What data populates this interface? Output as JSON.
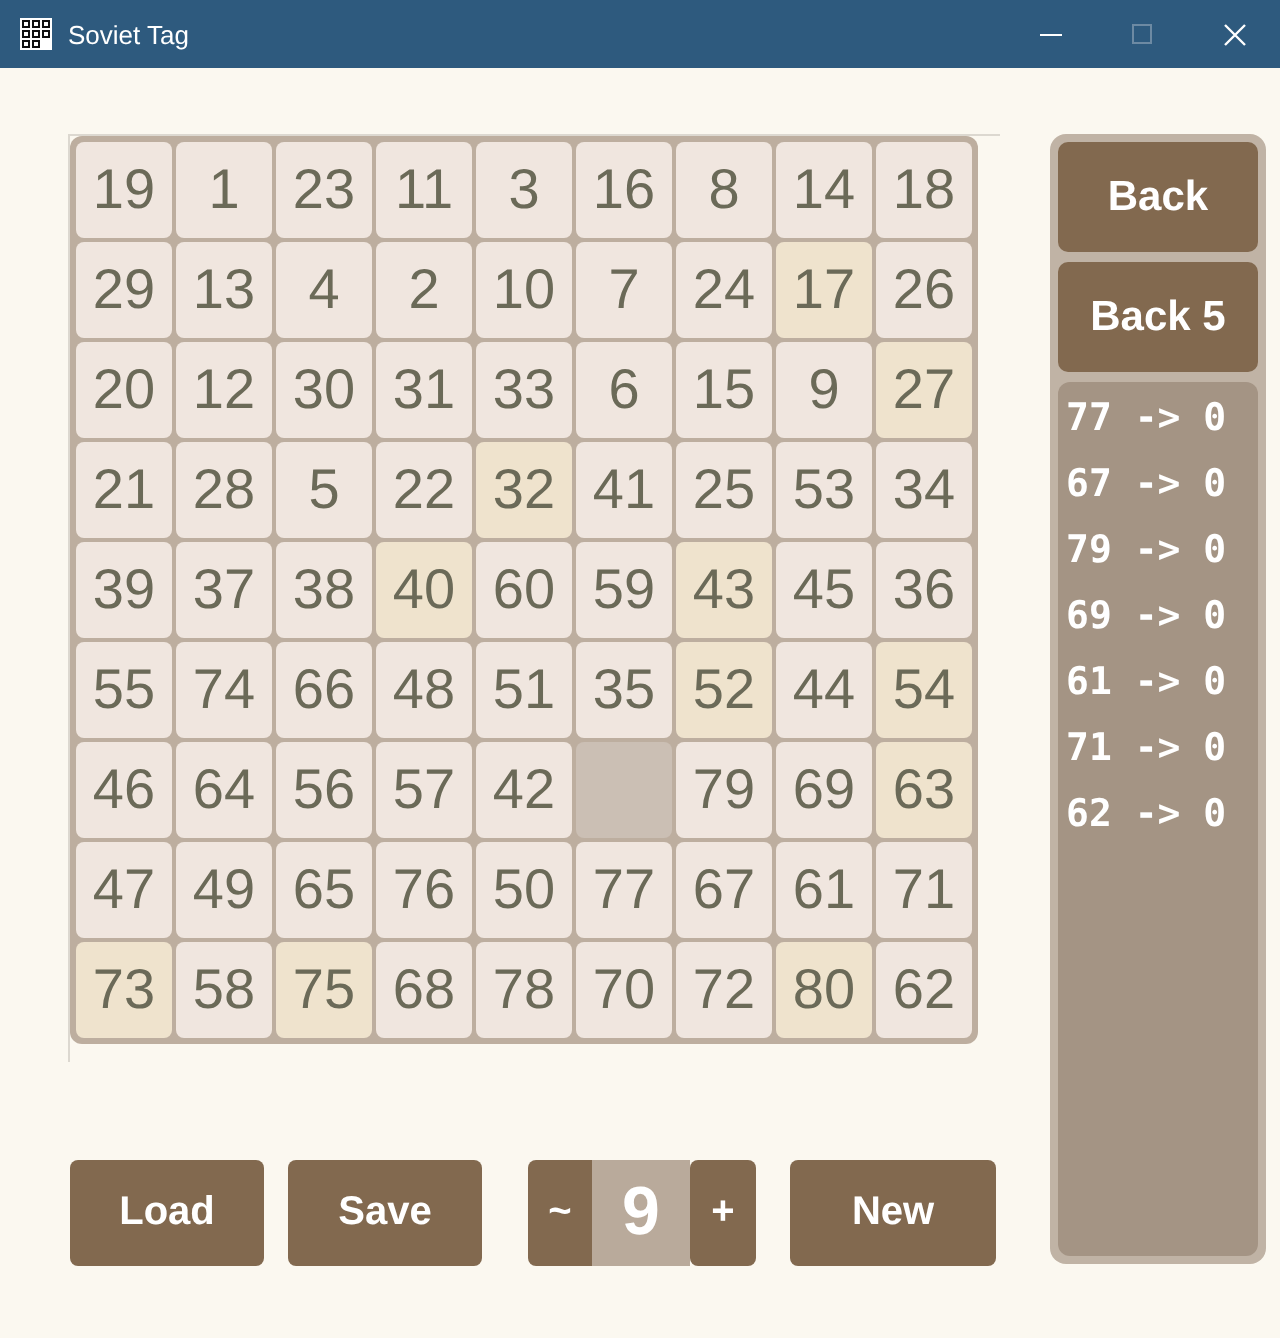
{
  "window": {
    "title": "Soviet Tag",
    "controls": [
      {
        "kind": "minimize",
        "disabled": false
      },
      {
        "kind": "maximize",
        "disabled": true
      },
      {
        "kind": "close",
        "disabled": false
      }
    ]
  },
  "board": {
    "rows": [
      [
        {
          "kind": "tile",
          "value": "19",
          "highlighted": false
        },
        {
          "kind": "tile",
          "value": "1",
          "highlighted": false
        },
        {
          "kind": "tile",
          "value": "23",
          "highlighted": false
        },
        {
          "kind": "tile",
          "value": "11",
          "highlighted": false
        },
        {
          "kind": "tile",
          "value": "3",
          "highlighted": false
        },
        {
          "kind": "tile",
          "value": "16",
          "highlighted": false
        },
        {
          "kind": "tile",
          "value": "8",
          "highlighted": false
        },
        {
          "kind": "tile",
          "value": "14",
          "highlighted": false
        },
        {
          "kind": "tile",
          "value": "18",
          "highlighted": false
        }
      ],
      [
        {
          "kind": "tile",
          "value": "29",
          "highlighted": false
        },
        {
          "kind": "tile",
          "value": "13",
          "highlighted": false
        },
        {
          "kind": "tile",
          "value": "4",
          "highlighted": false
        },
        {
          "kind": "tile",
          "value": "2",
          "highlighted": false
        },
        {
          "kind": "tile",
          "value": "10",
          "highlighted": false
        },
        {
          "kind": "tile",
          "value": "7",
          "highlighted": false
        },
        {
          "kind": "tile",
          "value": "24",
          "highlighted": false
        },
        {
          "kind": "tile",
          "value": "17",
          "highlighted": true
        },
        {
          "kind": "tile",
          "value": "26",
          "highlighted": false
        }
      ],
      [
        {
          "kind": "tile",
          "value": "20",
          "highlighted": false
        },
        {
          "kind": "tile",
          "value": "12",
          "highlighted": false
        },
        {
          "kind": "tile",
          "value": "30",
          "highlighted": false
        },
        {
          "kind": "tile",
          "value": "31",
          "highlighted": false
        },
        {
          "kind": "tile",
          "value": "33",
          "highlighted": false
        },
        {
          "kind": "tile",
          "value": "6",
          "highlighted": false
        },
        {
          "kind": "tile",
          "value": "15",
          "highlighted": false
        },
        {
          "kind": "tile",
          "value": "9",
          "highlighted": false
        },
        {
          "kind": "tile",
          "value": "27",
          "highlighted": true
        }
      ],
      [
        {
          "kind": "tile",
          "value": "21",
          "highlighted": false
        },
        {
          "kind": "tile",
          "value": "28",
          "highlighted": false
        },
        {
          "kind": "tile",
          "value": "5",
          "highlighted": false
        },
        {
          "kind": "tile",
          "value": "22",
          "highlighted": false
        },
        {
          "kind": "tile",
          "value": "32",
          "highlighted": true
        },
        {
          "kind": "tile",
          "value": "41",
          "highlighted": false
        },
        {
          "kind": "tile",
          "value": "25",
          "highlighted": false
        },
        {
          "kind": "tile",
          "value": "53",
          "highlighted": false
        },
        {
          "kind": "tile",
          "value": "34",
          "highlighted": false
        }
      ],
      [
        {
          "kind": "tile",
          "value": "39",
          "highlighted": false
        },
        {
          "kind": "tile",
          "value": "37",
          "highlighted": false
        },
        {
          "kind": "tile",
          "value": "38",
          "highlighted": false
        },
        {
          "kind": "tile",
          "value": "40",
          "highlighted": true
        },
        {
          "kind": "tile",
          "value": "60",
          "highlighted": false
        },
        {
          "kind": "tile",
          "value": "59",
          "highlighted": false
        },
        {
          "kind": "tile",
          "value": "43",
          "highlighted": true
        },
        {
          "kind": "tile",
          "value": "45",
          "highlighted": false
        },
        {
          "kind": "tile",
          "value": "36",
          "highlighted": false
        }
      ],
      [
        {
          "kind": "tile",
          "value": "55",
          "highlighted": false
        },
        {
          "kind": "tile",
          "value": "74",
          "highlighted": false
        },
        {
          "kind": "tile",
          "value": "66",
          "highlighted": false
        },
        {
          "kind": "tile",
          "value": "48",
          "highlighted": false
        },
        {
          "kind": "tile",
          "value": "51",
          "highlighted": false
        },
        {
          "kind": "tile",
          "value": "35",
          "highlighted": false
        },
        {
          "kind": "tile",
          "value": "52",
          "highlighted": true
        },
        {
          "kind": "tile",
          "value": "44",
          "highlighted": false
        },
        {
          "kind": "tile",
          "value": "54",
          "highlighted": true
        }
      ],
      [
        {
          "kind": "tile",
          "value": "46",
          "highlighted": false
        },
        {
          "kind": "tile",
          "value": "64",
          "highlighted": false
        },
        {
          "kind": "tile",
          "value": "56",
          "highlighted": false
        },
        {
          "kind": "tile",
          "value": "57",
          "highlighted": false
        },
        {
          "kind": "tile",
          "value": "42",
          "highlighted": false
        },
        {
          "kind": "empty"
        },
        {
          "kind": "tile",
          "value": "79",
          "highlighted": false
        },
        {
          "kind": "tile",
          "value": "69",
          "highlighted": false
        },
        {
          "kind": "tile",
          "value": "63",
          "highlighted": true
        }
      ],
      [
        {
          "kind": "tile",
          "value": "47",
          "highlighted": false
        },
        {
          "kind": "tile",
          "value": "49",
          "highlighted": false
        },
        {
          "kind": "tile",
          "value": "65",
          "highlighted": false
        },
        {
          "kind": "tile",
          "value": "76",
          "highlighted": false
        },
        {
          "kind": "tile",
          "value": "50",
          "highlighted": false
        },
        {
          "kind": "tile",
          "value": "77",
          "highlighted": false
        },
        {
          "kind": "tile",
          "value": "67",
          "highlighted": false
        },
        {
          "kind": "tile",
          "value": "61",
          "highlighted": false
        },
        {
          "kind": "tile",
          "value": "71",
          "highlighted": false
        }
      ],
      [
        {
          "kind": "tile",
          "value": "73",
          "highlighted": true
        },
        {
          "kind": "tile",
          "value": "58",
          "highlighted": false
        },
        {
          "kind": "tile",
          "value": "75",
          "highlighted": true
        },
        {
          "kind": "tile",
          "value": "68",
          "highlighted": false
        },
        {
          "kind": "tile",
          "value": "78",
          "highlighted": false
        },
        {
          "kind": "tile",
          "value": "70",
          "highlighted": false
        },
        {
          "kind": "tile",
          "value": "72",
          "highlighted": false
        },
        {
          "kind": "tile",
          "value": "80",
          "highlighted": true
        },
        {
          "kind": "tile",
          "value": "62",
          "highlighted": false
        }
      ]
    ]
  },
  "side_panel": {
    "buttons": [
      "Back",
      "Back 5"
    ],
    "move_log": [
      "77 -> 0",
      "67 -> 0",
      "79 -> 0",
      "69 -> 0",
      "61 -> 0",
      "71 -> 0",
      "62 -> 0"
    ]
  },
  "bottom_bar": {
    "load": "Load",
    "save": "Save",
    "size_stepper": {
      "decrement": "~",
      "value": "9",
      "increment": "+"
    },
    "new": "New"
  }
}
